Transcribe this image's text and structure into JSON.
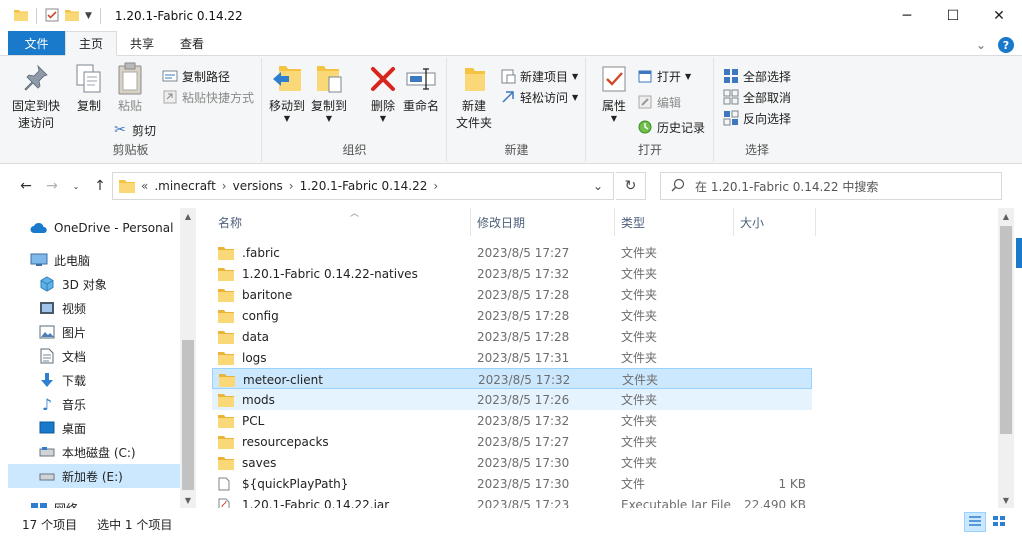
{
  "window": {
    "title": "1.20.1-Fabric 0.14.22",
    "minimize": "─",
    "maximize": "☐",
    "close": "✕"
  },
  "tabs": {
    "file": "文件",
    "home": "主页",
    "share": "共享",
    "view": "查看",
    "expand_glyph": "⌄",
    "help": "?"
  },
  "ribbon": {
    "clipboard": {
      "label": "剪贴板",
      "pin": "固定到快速访问",
      "pin_line1": "固定到快",
      "pin_line2": "速访问",
      "copy": "复制",
      "paste": "粘贴",
      "copy_path": "复制路径",
      "paste_shortcut": "粘贴快捷方式",
      "cut": "剪切"
    },
    "organize": {
      "label": "组织",
      "move_to": "移动到",
      "copy_to": "复制到",
      "delete": "删除",
      "rename": "重命名"
    },
    "new": {
      "label": "新建",
      "new_folder_line1": "新建",
      "new_folder_line2": "文件夹",
      "new_item": "新建项目",
      "easy_access": "轻松访问"
    },
    "open": {
      "label": "打开",
      "properties": "属性",
      "open": "打开",
      "edit": "编辑",
      "history": "历史记录"
    },
    "select": {
      "label": "选择",
      "select_all": "全部选择",
      "select_none": "全部取消",
      "invert": "反向选择"
    }
  },
  "address": {
    "overflow": "«",
    "crumbs": [
      ".minecraft",
      "versions",
      "1.20.1-Fabric 0.14.22"
    ],
    "sep": "›",
    "search_placeholder": "在 1.20.1-Fabric 0.14.22 中搜索"
  },
  "sidebar": {
    "items": [
      {
        "label": "OneDrive - Personal",
        "icon": "cloud-icon"
      },
      {
        "label": "此电脑",
        "icon": "computer-icon"
      },
      {
        "label": "3D 对象",
        "icon": "cube-icon"
      },
      {
        "label": "视频",
        "icon": "video-icon"
      },
      {
        "label": "图片",
        "icon": "picture-icon"
      },
      {
        "label": "文档",
        "icon": "document-icon"
      },
      {
        "label": "下载",
        "icon": "download-icon"
      },
      {
        "label": "音乐",
        "icon": "music-icon"
      },
      {
        "label": "桌面",
        "icon": "desktop-icon"
      },
      {
        "label": "本地磁盘 (C:)",
        "icon": "drive-icon"
      },
      {
        "label": "新加卷 (E:)",
        "icon": "drive-icon"
      },
      {
        "label": "网络",
        "icon": "network-icon"
      }
    ]
  },
  "columns": {
    "name": "名称",
    "date": "修改日期",
    "type": "类型",
    "size": "大小"
  },
  "files": [
    {
      "name": ".fabric",
      "date": "2023/8/5 17:27",
      "type": "文件夹",
      "size": "",
      "kind": "folder"
    },
    {
      "name": "1.20.1-Fabric 0.14.22-natives",
      "date": "2023/8/5 17:32",
      "type": "文件夹",
      "size": "",
      "kind": "folder"
    },
    {
      "name": "baritone",
      "date": "2023/8/5 17:28",
      "type": "文件夹",
      "size": "",
      "kind": "folder"
    },
    {
      "name": "config",
      "date": "2023/8/5 17:28",
      "type": "文件夹",
      "size": "",
      "kind": "folder"
    },
    {
      "name": "data",
      "date": "2023/8/5 17:28",
      "type": "文件夹",
      "size": "",
      "kind": "folder"
    },
    {
      "name": "logs",
      "date": "2023/8/5 17:31",
      "type": "文件夹",
      "size": "",
      "kind": "folder"
    },
    {
      "name": "meteor-client",
      "date": "2023/8/5 17:32",
      "type": "文件夹",
      "size": "",
      "kind": "folder"
    },
    {
      "name": "mods",
      "date": "2023/8/5 17:26",
      "type": "文件夹",
      "size": "",
      "kind": "folder"
    },
    {
      "name": "PCL",
      "date": "2023/8/5 17:32",
      "type": "文件夹",
      "size": "",
      "kind": "folder"
    },
    {
      "name": "resourcepacks",
      "date": "2023/8/5 17:27",
      "type": "文件夹",
      "size": "",
      "kind": "folder"
    },
    {
      "name": "saves",
      "date": "2023/8/5 17:30",
      "type": "文件夹",
      "size": "",
      "kind": "folder"
    },
    {
      "name": "${quickPlayPath}",
      "date": "2023/8/5 17:30",
      "type": "文件",
      "size": "1 KB",
      "kind": "file"
    },
    {
      "name": "1.20.1-Fabric 0.14.22.jar",
      "date": "2023/8/5 17:23",
      "type": "Executable Jar File",
      "size": "22,490 KB",
      "kind": "jar"
    }
  ],
  "status": {
    "count": "17 个项目",
    "selected": "选中 1 个项目"
  },
  "colors": {
    "accent": "#1979ca",
    "folder": "#f4c342",
    "selection": "#cce8ff",
    "hover": "#e5f3ff"
  }
}
